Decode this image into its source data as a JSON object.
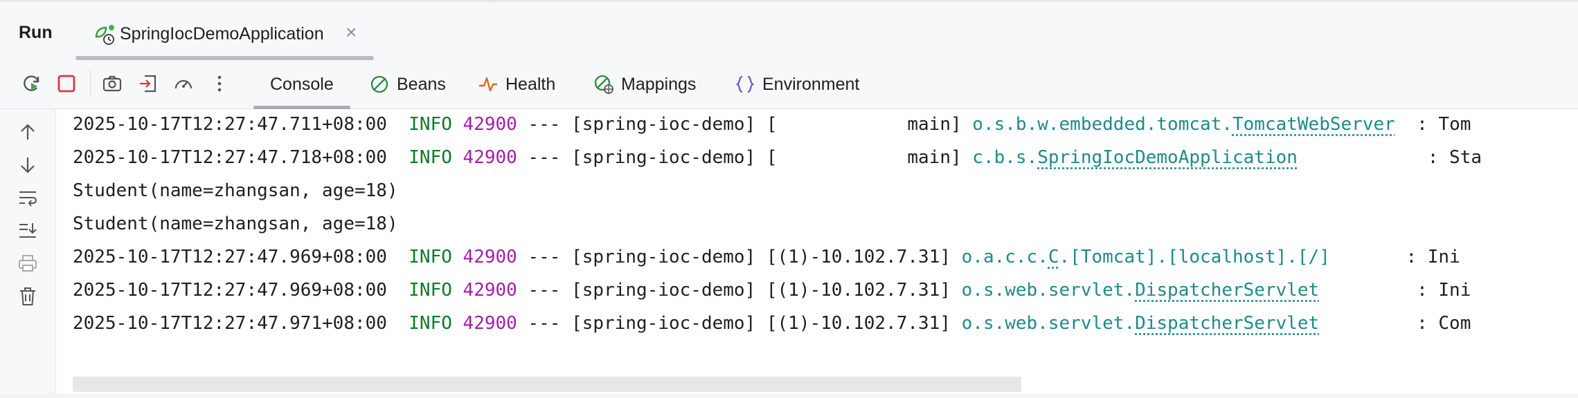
{
  "run_header": {
    "title": "Run",
    "tab_label": "SpringIocDemoApplication",
    "close_symbol": "×"
  },
  "toolbar": {
    "buttons": [
      "rerun-icon",
      "stop-icon",
      "camera-icon",
      "exit-icon",
      "speedometer-icon",
      "more-icon"
    ],
    "tabs": [
      {
        "label": "Console",
        "icon": "",
        "active": true
      },
      {
        "label": "Beans",
        "icon": "beans-icon"
      },
      {
        "label": "Health",
        "icon": "health-icon"
      },
      {
        "label": "Mappings",
        "icon": "mappings-icon"
      },
      {
        "label": "Environment",
        "icon": "environment-icon"
      }
    ]
  },
  "side_toolbar": [
    "arrow-up-icon",
    "arrow-down-icon",
    "soft-wrap-icon",
    "scroll-to-end-icon",
    "print-icon",
    "trash-icon"
  ],
  "colors": {
    "level": "#0b7a27",
    "pid": "#a31da8",
    "logger": "#1d8a8a",
    "stop": "#e0353c",
    "health": "#e06a1c",
    "environment": "#7a4fd9"
  },
  "console": {
    "lines": [
      {
        "ts": "2025-10-17T12:27:47.711+08:00",
        "level": "INFO",
        "pid": "42900",
        "sep": "---",
        "app": "[spring-ioc-demo]",
        "thread": "[            main]",
        "logger_pkg": "o.s.b.w.embedded.tomcat.",
        "logger_cls": "TomcatWebServer",
        "pad": "  ",
        "msg": ": Tom"
      },
      {
        "ts": "2025-10-17T12:27:47.718+08:00",
        "level": "INFO",
        "pid": "42900",
        "sep": "---",
        "app": "[spring-ioc-demo]",
        "thread": "[            main]",
        "logger_pkg": "c.b.s.",
        "logger_cls": "SpringIocDemoApplication",
        "pad": "            ",
        "msg": ": Sta"
      },
      {
        "plain": "Student(name=zhangsan, age=18)"
      },
      {
        "plain": "Student(name=zhangsan, age=18)"
      },
      {
        "ts": "2025-10-17T12:27:47.969+08:00",
        "level": "INFO",
        "pid": "42900",
        "sep": "---",
        "app": "[spring-ioc-demo]",
        "thread": "[(1)-10.102.7.31]",
        "logger_pkg": "o.a.c.c.",
        "logger_cls": "C",
        "logger_rest": ".[Tomcat].[localhost].[/]",
        "pad": "       ",
        "msg": ": Ini"
      },
      {
        "ts": "2025-10-17T12:27:47.969+08:00",
        "level": "INFO",
        "pid": "42900",
        "sep": "---",
        "app": "[spring-ioc-demo]",
        "thread": "[(1)-10.102.7.31]",
        "logger_pkg": "o.s.web.servlet.",
        "logger_cls": "DispatcherServlet",
        "pad": "         ",
        "msg": ": Ini"
      },
      {
        "ts": "2025-10-17T12:27:47.971+08:00",
        "level": "INFO",
        "pid": "42900",
        "sep": "---",
        "app": "[spring-ioc-demo]",
        "thread": "[(1)-10.102.7.31]",
        "logger_pkg": "o.s.web.servlet.",
        "logger_cls": "DispatcherServlet",
        "pad": "         ",
        "msg": ": Com"
      }
    ]
  }
}
